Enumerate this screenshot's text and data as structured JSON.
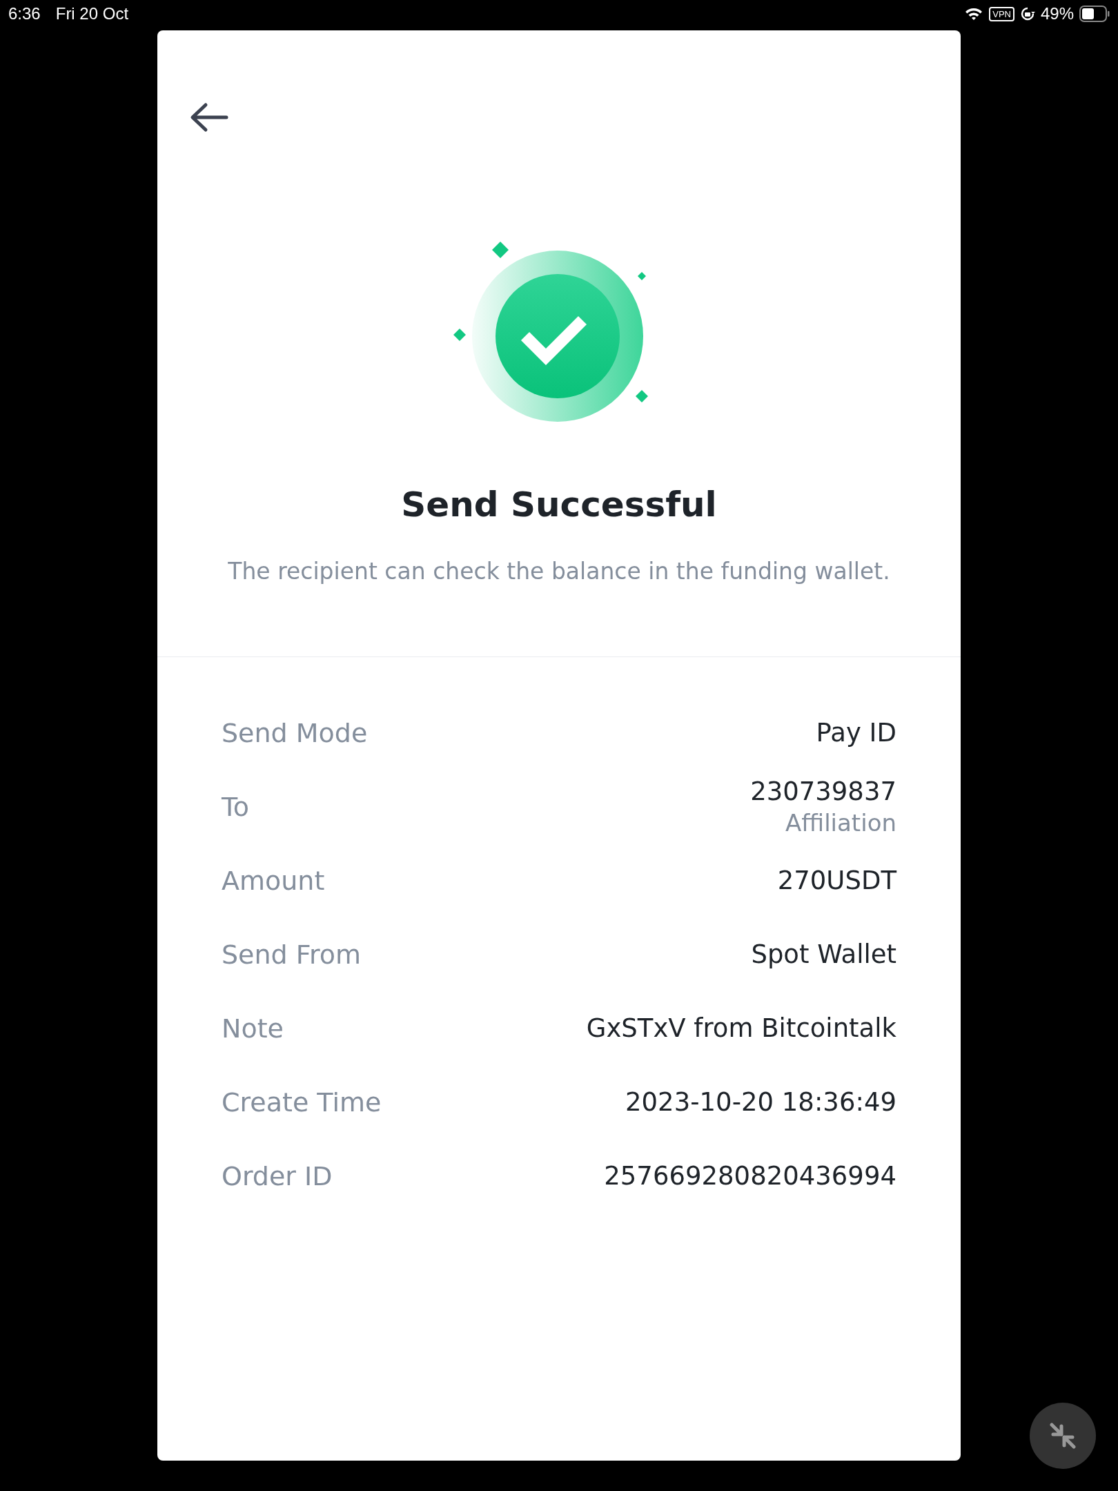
{
  "status_bar": {
    "time": "6:36",
    "date": "Fri 20 Oct",
    "vpn": "VPN",
    "battery": "49%"
  },
  "title": "Send Successful",
  "subtitle": "The recipient can check the balance in the funding wallet.",
  "details": [
    {
      "label": "Send Mode",
      "value": "Pay ID"
    },
    {
      "label": "To",
      "value": "230739837",
      "secondary": "Affiliation"
    },
    {
      "label": "Amount",
      "value": "270USDT"
    },
    {
      "label": "Send From",
      "value": "Spot Wallet"
    },
    {
      "label": "Note",
      "value": "GxSTxV from Bitcointalk"
    },
    {
      "label": "Create Time",
      "value": "2023-10-20 18:36:49"
    },
    {
      "label": "Order ID",
      "value": "257669280820436994"
    }
  ]
}
